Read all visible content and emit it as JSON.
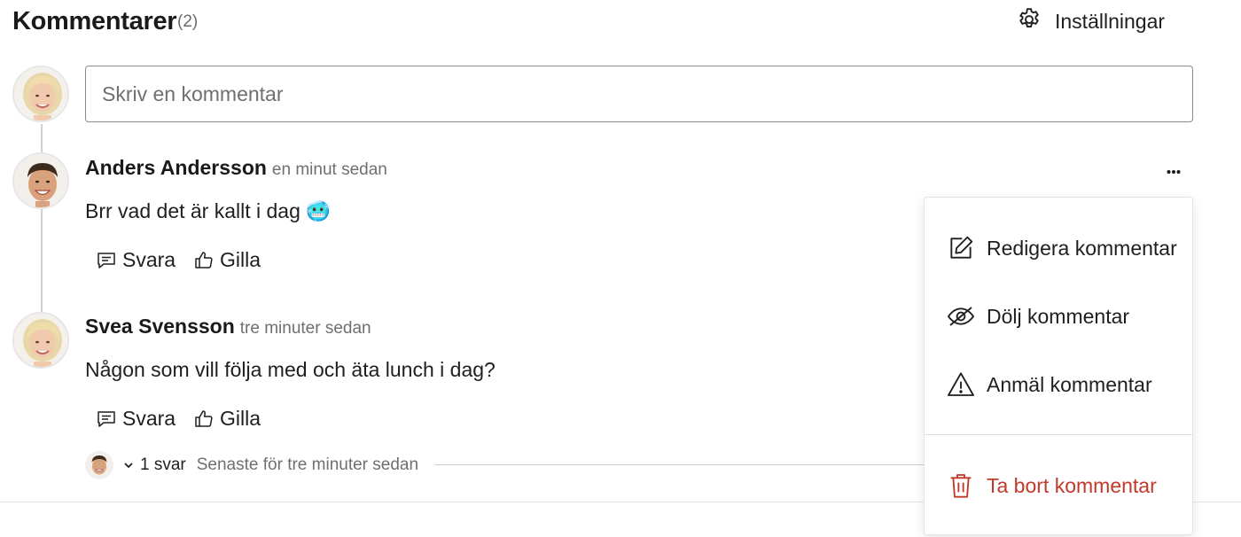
{
  "header": {
    "title": "Kommentarer",
    "count": "(2)",
    "settings_label": "Inställningar"
  },
  "input": {
    "placeholder": "Skriv en kommentar"
  },
  "comments": [
    {
      "author": "Anders Andersson",
      "time": "en minut sedan",
      "text": "Brr vad det är kallt i dag",
      "emoji": "🥶",
      "reply_label": "Svara",
      "like_label": "Gilla"
    },
    {
      "author": "Svea Svensson",
      "time": "tre minuter sedan",
      "text": "Någon som vill följa med och äta lunch i dag?",
      "reply_label": "Svara",
      "like_label": "Gilla",
      "replies": {
        "count_label": "1 svar",
        "latest_label": "Senaste för tre minuter sedan"
      }
    }
  ],
  "menu": {
    "items": [
      {
        "label": "Redigera kommentar",
        "icon": "edit-icon"
      },
      {
        "label": "Dölj kommentar",
        "icon": "eye-off-icon"
      },
      {
        "label": "Anmäl kommentar",
        "icon": "warning-icon"
      },
      {
        "label": "Ta bort kommentar",
        "icon": "trash-icon",
        "color": "#c0392b"
      }
    ]
  },
  "colors": {
    "danger": "#c0392b",
    "muted": "#6f6f6f",
    "text": "#1f1f1f"
  }
}
